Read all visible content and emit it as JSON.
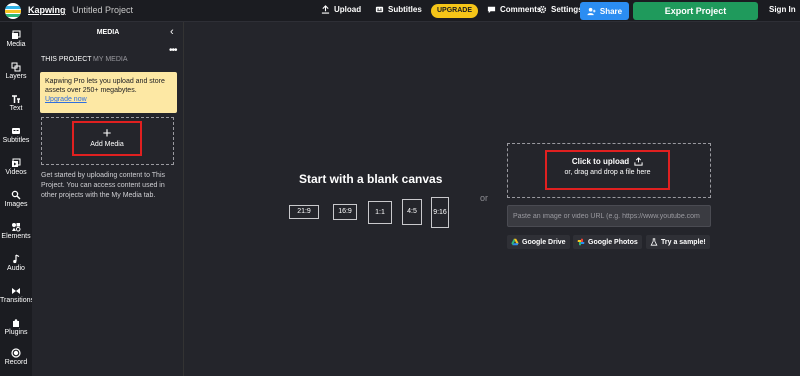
{
  "app": {
    "brand": "Kapwing",
    "crumb_separator": "›",
    "project_title": "Untitled Project"
  },
  "toolbar": {
    "upload_label": "Upload",
    "subtitles_label": "Subtitles",
    "upgrade_label": "UPGRADE",
    "comments_label": "Comments",
    "settings_label": "Settings",
    "share_label": "Share",
    "export_label": "Export Project",
    "signin_label": "Sign In"
  },
  "rail": [
    {
      "label": "Media",
      "icon": "media-icon"
    },
    {
      "label": "Layers",
      "icon": "layers-icon"
    },
    {
      "label": "Text",
      "icon": "text-icon"
    },
    {
      "label": "Subtitles",
      "icon": "subtitles-icon"
    },
    {
      "label": "Videos",
      "icon": "videos-icon"
    },
    {
      "label": "Images",
      "icon": "images-icon"
    },
    {
      "label": "Elements",
      "icon": "elements-icon"
    },
    {
      "label": "Audio",
      "icon": "audio-icon"
    },
    {
      "label": "Transitions",
      "icon": "transitions-icon"
    },
    {
      "label": "Plugins",
      "icon": "plugins-icon"
    },
    {
      "label": "Record",
      "icon": "record-icon"
    }
  ],
  "panel": {
    "title": "MEDIA",
    "tab_project": "THIS PROJECT",
    "tab_my_media": "MY MEDIA",
    "promo_text": "Kapwing Pro lets you upload and store assets over 250+ megabytes.",
    "promo_link": "Upgrade now",
    "add_media_label": "Add Media",
    "info_text": "Get started by uploading content to This Project. You can access content used in other projects with the My Media tab."
  },
  "canvas": {
    "title": "Start with a blank canvas",
    "ratios": [
      "21:9",
      "16:9",
      "1:1",
      "4:5",
      "9:16"
    ],
    "or_label": "or"
  },
  "upload": {
    "click_label": "Click to upload",
    "drag_label": "or, drag and drop a file here",
    "url_placeholder": "Paste an image or video URL (e.g. https://www.youtube.com",
    "google_drive_label": "Google Drive",
    "google_photos_label": "Google Photos",
    "sample_label": "Try a sample!"
  },
  "colors": {
    "accent_red": "#e02020",
    "share_blue": "#2b8df2",
    "export_green": "#1f9a5c",
    "upgrade_yellow": "#f5c518",
    "promo_bg": "#fde8a4"
  }
}
